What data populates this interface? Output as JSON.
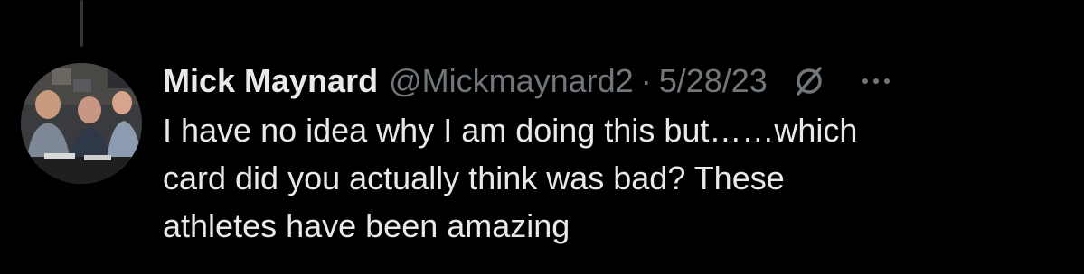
{
  "tweet": {
    "display_name": "Mick Maynard",
    "handle": "@Mickmaynard2",
    "separator": "·",
    "date": "5/28/23",
    "text_lines": [
      "I have no idea why I am doing this but……which",
      "card did you actually think was bad? These",
      "athletes have been amazing"
    ]
  },
  "icons": {
    "avatar": "avatar",
    "header_icon": "slashed-circle-icon",
    "more": "more-options-icon"
  },
  "colors": {
    "background": "#000000",
    "primary_text": "#e7e9ea",
    "secondary_text": "#71767b",
    "thread_line": "#333639"
  }
}
